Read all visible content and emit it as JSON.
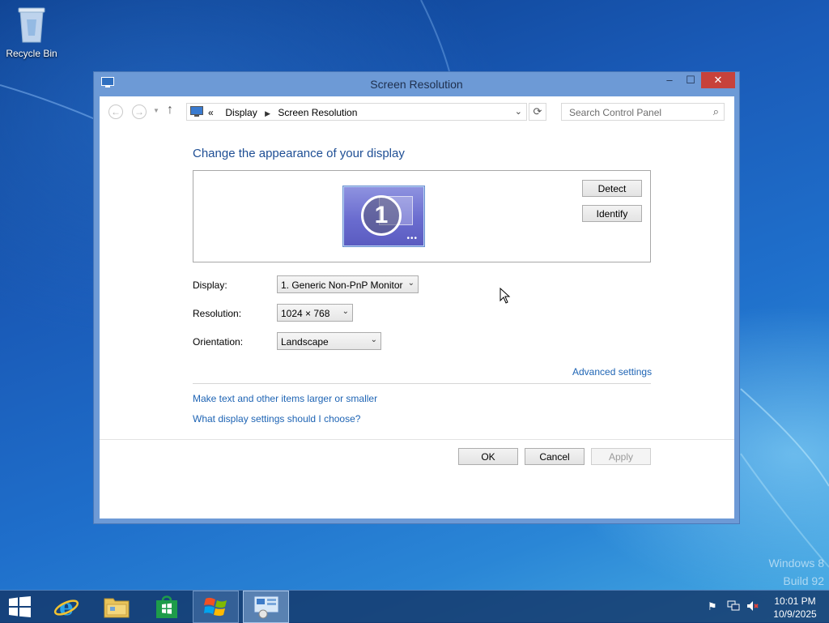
{
  "desktop": {
    "recycle_bin_label": "Recycle Bin",
    "watermark_line1": "Windows 8",
    "watermark_line2": "Build 92"
  },
  "window": {
    "title": "Screen Resolution",
    "icons": {
      "app": "display-icon",
      "minimize": "minimize-icon",
      "maximize": "maximize-icon",
      "close": "close-icon"
    }
  },
  "navbar": {
    "overflow": "«",
    "breadcrumb": [
      "Display",
      "Screen Resolution"
    ],
    "search_placeholder": "Search Control Panel",
    "icons": {
      "back": "back-arrow-icon",
      "forward": "forward-arrow-icon",
      "up": "up-arrow-icon",
      "refresh": "refresh-icon",
      "search": "search-icon"
    }
  },
  "content": {
    "heading": "Change the appearance of your display",
    "monitor_number": "1",
    "detect_label": "Detect",
    "identify_label": "Identify",
    "display_label": "Display:",
    "display_value": "1. Generic Non-PnP Monitor",
    "resolution_label": "Resolution:",
    "resolution_value": "1024 × 768",
    "orientation_label": "Orientation:",
    "orientation_value": "Landscape",
    "advanced_link": "Advanced settings",
    "text_size_link": "Make text and other items larger or smaller",
    "help_link": "What display settings should I choose?"
  },
  "footer": {
    "ok_label": "OK",
    "cancel_label": "Cancel",
    "apply_label": "Apply"
  },
  "taskbar": {
    "icons": [
      "start-icon",
      "internet-explorer-icon",
      "file-explorer-icon",
      "store-icon",
      "windows-7-icon",
      "control-panel-icon"
    ],
    "tray_icons": [
      "action-center-flag-icon",
      "network-icon",
      "volume-muted-icon"
    ],
    "time": "10:01 PM",
    "date": "10/9/2025"
  },
  "colors": {
    "link": "#1e64b4",
    "heading": "#1e4e94",
    "close_button": "#c7423b",
    "window_frame": "#6d9ad6"
  }
}
